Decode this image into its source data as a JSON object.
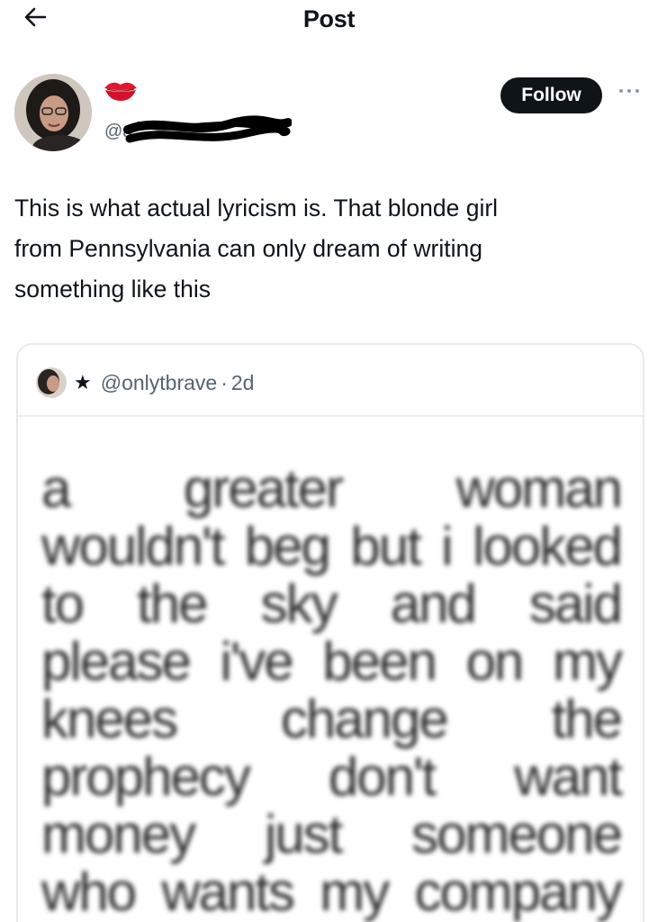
{
  "header": {
    "title": "Post",
    "back_icon": "arrow-left-icon"
  },
  "author": {
    "handle": "@a",
    "handle_obscured": true,
    "avatar": "profile-photo",
    "emoji_icon": "kiss-mark-icon"
  },
  "actions": {
    "follow_label": "Follow",
    "more_icon": "more-dots-icon"
  },
  "post": {
    "lines": [
      "This is what actual lyricism is. That blonde girl",
      "from Pennsylvania can only dream of writing",
      "something like this"
    ]
  },
  "quote": {
    "star": "★",
    "handle": "@onlytbrave",
    "separator": "·",
    "time": "2d",
    "blurred_lines": [
      [
        "a",
        "greater",
        "woman"
      ],
      [
        "wouldn't",
        "beg",
        "but",
        "i",
        "looked"
      ],
      [
        "to",
        "the",
        "sky",
        "and",
        "said"
      ],
      [
        "please",
        "i've",
        "been",
        "on",
        "my"
      ],
      [
        "knees",
        "change",
        "the"
      ],
      [
        "prophecy",
        "don't",
        "want"
      ],
      [
        "money",
        "just",
        "someone"
      ],
      [
        "who",
        "wants",
        "my",
        "company"
      ]
    ]
  },
  "colors": {
    "text": "#0f1419",
    "muted": "#536471",
    "button_bg": "#0f1419",
    "button_text": "#ffffff",
    "kiss": "#e0182d"
  }
}
